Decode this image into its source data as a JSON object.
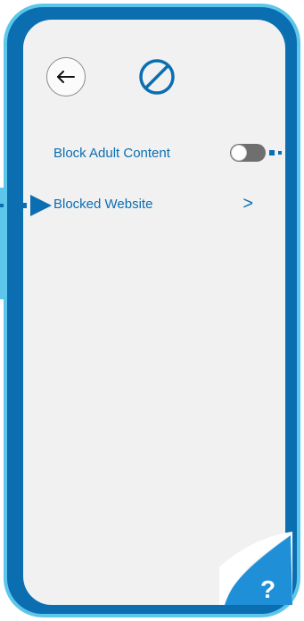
{
  "header": {
    "back_icon": "arrow-left-icon",
    "title_icon": "block-icon"
  },
  "settings": {
    "block_adult_content": {
      "label": "Block Adult Content",
      "enabled": false
    },
    "blocked_website": {
      "label": "Blocked Website",
      "chevron": ">"
    }
  },
  "help": {
    "label": "?"
  },
  "colors": {
    "frame": "#0b6eb1",
    "frame_border": "#5cc7ea",
    "screen_bg": "#f1f1f1",
    "text": "#0b6eb1",
    "toggle_off": "#6f6f6f"
  }
}
